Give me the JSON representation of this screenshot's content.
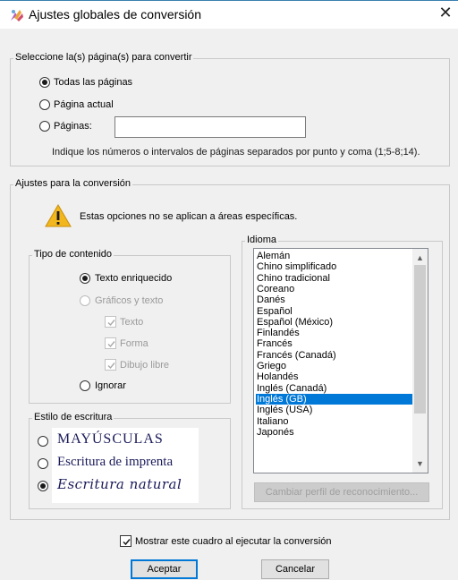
{
  "window": {
    "title": "Ajustes globales de conversión",
    "icon": "conversion-app-icon",
    "close_glyph": "✕"
  },
  "pages_group": {
    "legend": "Seleccione la(s) página(s) para convertir",
    "options": [
      {
        "label": "Todas las páginas",
        "checked": true
      },
      {
        "label": "Página actual",
        "checked": false
      },
      {
        "label": "Páginas:",
        "checked": false
      }
    ],
    "pages_input_value": "",
    "hint": "Indique los números o intervalos de páginas separados por punto y coma (1;5-8;14)."
  },
  "conversion_group": {
    "legend": "Ajustes para la conversión",
    "warning_icon": "warning-icon",
    "warning_text": "Estas opciones no se aplican a áreas específicas.",
    "content_type": {
      "legend": "Tipo de contenido",
      "rich_text": "Texto enriquecido",
      "graphics_text": "Gráficos y texto",
      "text": "Texto",
      "shape": "Forma",
      "freehand": "Dibujo libre",
      "ignore": "Ignorar"
    },
    "writing_style": {
      "legend": "Estilo de escritura",
      "options": [
        "MAYÚSCULAS",
        "Escritura de imprenta",
        "Escritura natural"
      ],
      "selected_index": 2
    },
    "language": {
      "legend": "Idioma",
      "items": [
        "Alemán",
        "Chino simplificado",
        "Chino tradicional",
        "Coreano",
        "Danés",
        "Español",
        "Español (México)",
        "Finlandés",
        "Francés",
        "Francés (Canadá)",
        "Griego",
        "Holandés",
        "Inglés (Canadá)",
        "Inglés (GB)",
        "Inglés (USA)",
        "Italiano",
        "Japonés"
      ],
      "selected": "Inglés (GB)",
      "change_profile_button": "Cambiar perfil de reconocimiento..."
    }
  },
  "show_dialog_checkbox": {
    "label": "Mostrar este cuadro al ejecutar la conversión",
    "checked": true
  },
  "buttons": {
    "accept": "Aceptar",
    "cancel": "Cancelar"
  },
  "colors": {
    "selection": "#0078d7",
    "warning": "#f2b71d",
    "accent_border": "#0078d7"
  }
}
